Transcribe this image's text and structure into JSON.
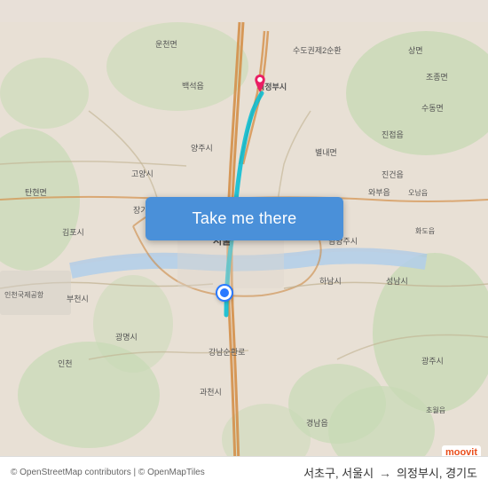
{
  "map": {
    "background_color": "#e8e0d8",
    "button_label": "Take me there",
    "button_color": "#4a90d9",
    "dot_color": "#2979ff"
  },
  "route": {
    "from": "서초구, 서울시",
    "arrow": "→",
    "to": "의정부시, 경기도"
  },
  "attribution": {
    "text": "© OpenStreetMap contributors | © OpenMapTiles"
  },
  "branding": {
    "name": "moovit"
  }
}
